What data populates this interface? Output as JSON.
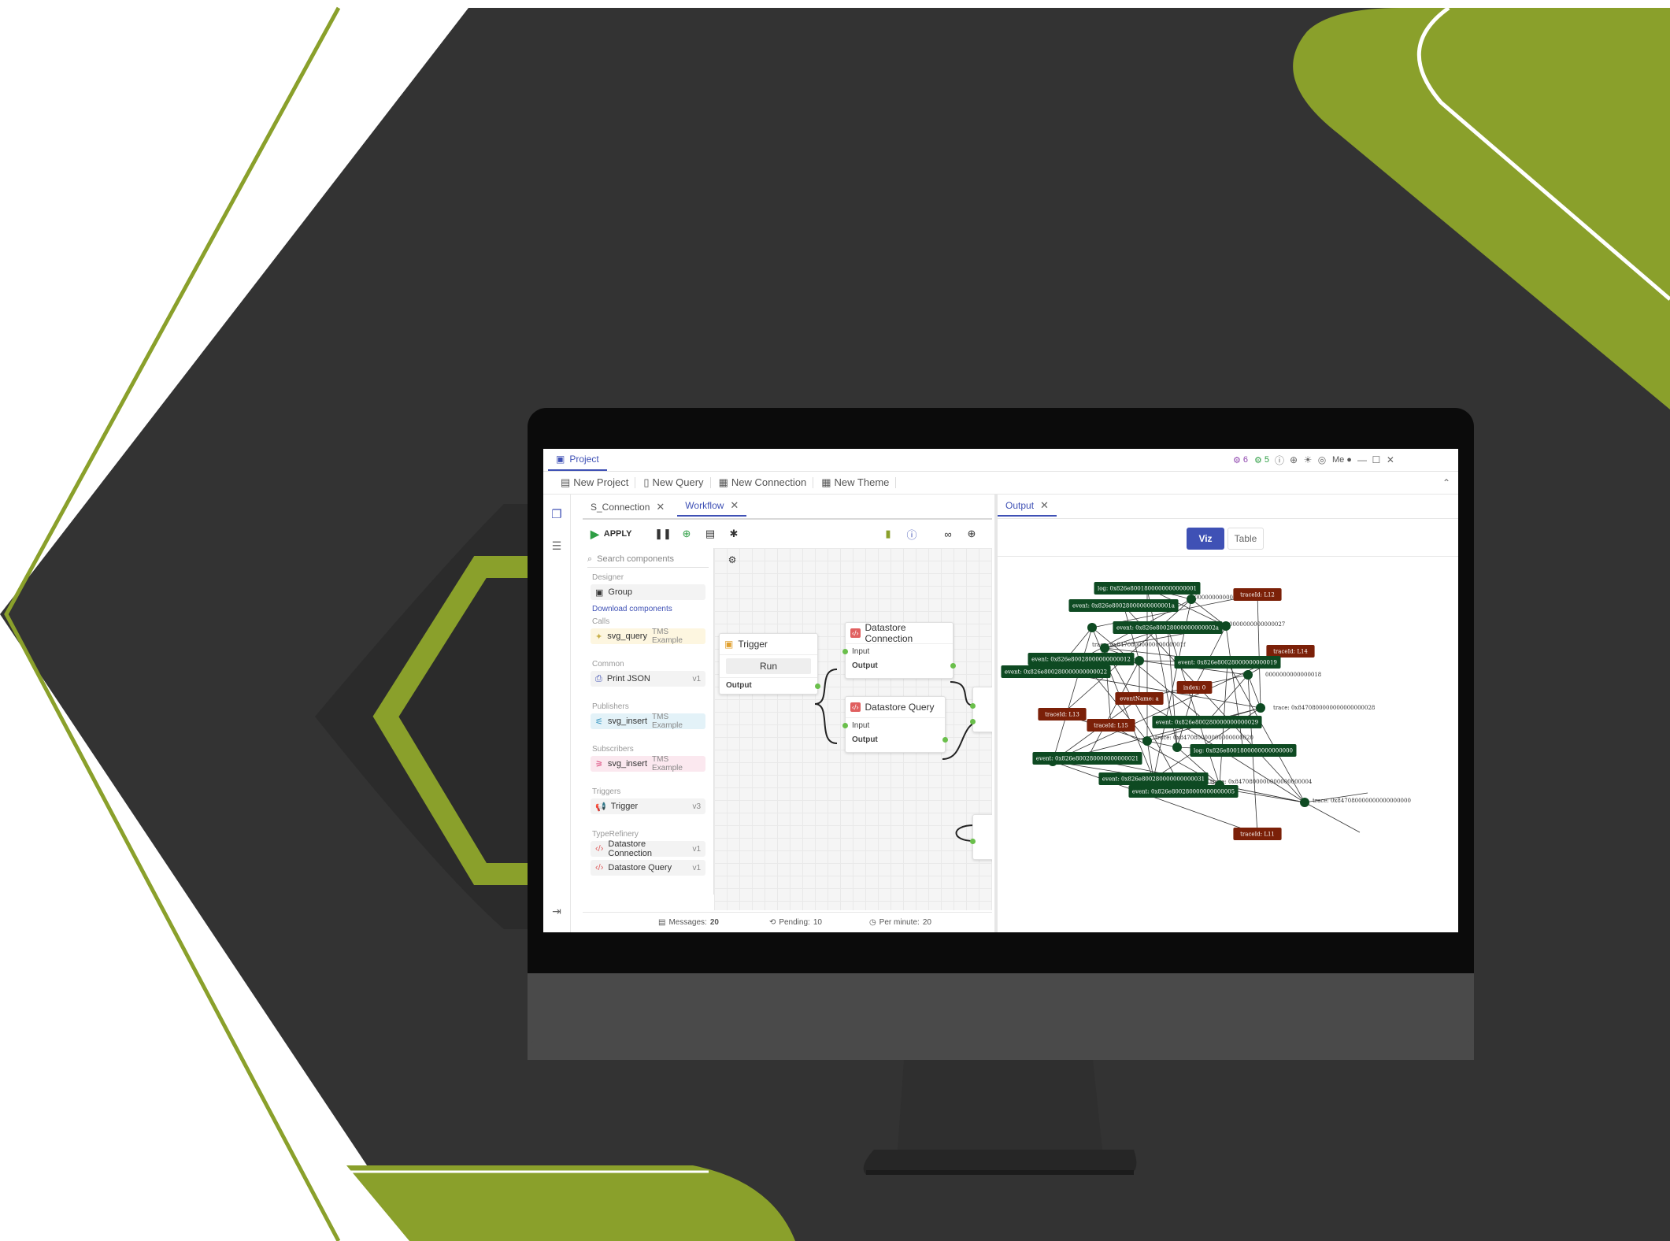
{
  "app": {
    "project_label": "Project",
    "indicators": [
      {
        "value": "6",
        "color": "#8e44ad"
      },
      {
        "value": "5",
        "color": "#2e9e44"
      }
    ],
    "user_label": "Me"
  },
  "menubar": {
    "items": [
      {
        "label": "New Project"
      },
      {
        "label": "New Query"
      },
      {
        "label": "New Connection"
      },
      {
        "label": "New Theme"
      }
    ]
  },
  "editor": {
    "tabs": [
      {
        "label": "S_Connection",
        "active": false
      },
      {
        "label": "Workflow",
        "active": true
      }
    ],
    "apply_label": "APPLY"
  },
  "palette": {
    "search_placeholder": "Search components",
    "sections": [
      {
        "title": "Designer",
        "items": [
          {
            "label": "Group",
            "version": "",
            "bg": "#f3f3f3"
          }
        ],
        "link": "Download components"
      },
      {
        "title": "Calls",
        "items": [
          {
            "label": "svg_query",
            "version": "TMS Example",
            "bg": "#fdf6e0"
          }
        ]
      },
      {
        "title": "Common",
        "items": [
          {
            "label": "Print JSON",
            "version": "v1",
            "bg": "#f3f3f3"
          }
        ]
      },
      {
        "title": "Publishers",
        "items": [
          {
            "label": "svg_insert",
            "version": "TMS Example",
            "bg": "#e3f2f8"
          }
        ]
      },
      {
        "title": "Subscribers",
        "items": [
          {
            "label": "svg_insert",
            "version": "TMS Example",
            "bg": "#fbe8ef"
          }
        ]
      },
      {
        "title": "Triggers",
        "items": [
          {
            "label": "Trigger",
            "version": "v3",
            "bg": "#f3f3f3"
          }
        ]
      },
      {
        "title": "TypeRefinery",
        "items": [
          {
            "label": "Datastore Connection",
            "version": "v1",
            "bg": "#f3f3f3"
          },
          {
            "label": "Datastore Query",
            "version": "v1",
            "bg": "#f3f3f3"
          }
        ]
      }
    ]
  },
  "canvas": {
    "trigger": {
      "title": "Trigger",
      "button": "Run",
      "output": "Output"
    },
    "ds_connection": {
      "title": "Datastore Connection",
      "input": "Input",
      "output": "Output"
    },
    "ds_query": {
      "title": "Datastore Query",
      "input": "Input",
      "output": "Output"
    }
  },
  "status": {
    "messages_label": "Messages:",
    "messages_value": "20",
    "pending_label": "Pending:",
    "pending_value": "10",
    "per_minute_label": "Per minute:",
    "per_minute_value": "20"
  },
  "output": {
    "tab_label": "Output",
    "viz_label": "Viz",
    "table_label": "Table",
    "graph_nodes": [
      {
        "label": "log: 0x826e8001800000000000001",
        "kind": "green"
      },
      {
        "label": "event: 0x826e80028000000000001a",
        "kind": "green"
      },
      {
        "label": "traceId: L12",
        "kind": "red"
      },
      {
        "label": "event: 0x826e80028000000000002a",
        "kind": "green"
      },
      {
        "label": "traceId: L14",
        "kind": "red"
      },
      {
        "label": "event: 0x826e80028000000000012",
        "kind": "green"
      },
      {
        "label": "event: 0x826e80028000000000019",
        "kind": "green"
      },
      {
        "label": "event: 0x826e800280000000000022",
        "kind": "green"
      },
      {
        "label": "index: 0",
        "kind": "red"
      },
      {
        "label": "eventName: a",
        "kind": "red"
      },
      {
        "label": "traceId: L13",
        "kind": "red"
      },
      {
        "label": "traceId: L15",
        "kind": "red"
      },
      {
        "label": "event: 0x826e800280000000000029",
        "kind": "green"
      },
      {
        "label": "log: 0x826e8001800000000000000",
        "kind": "green"
      },
      {
        "label": "event: 0x826e800280000000000021",
        "kind": "green"
      },
      {
        "label": "event: 0x826e800280000000000031",
        "kind": "green"
      },
      {
        "label": "event: 0x826e800280000000000005",
        "kind": "green"
      },
      {
        "label": "traceId: L11",
        "kind": "red"
      }
    ],
    "edge_labels": [
      "0000000000000017",
      "0000000000000027",
      "trace: 0x8470800000000000001f",
      "0000000000000018",
      "trace: 0x8470800000000000000028",
      "trace: 0x847080000000000000020",
      "trace: 0x8470800000000000000004",
      "trace: 0x847080000000000000000"
    ]
  },
  "colors": {
    "accent": "#3f51b5",
    "brand_green": "#8aa02b",
    "dark_bg": "#333333",
    "node_green": "#0e4a22",
    "node_red": "#7b2008"
  }
}
